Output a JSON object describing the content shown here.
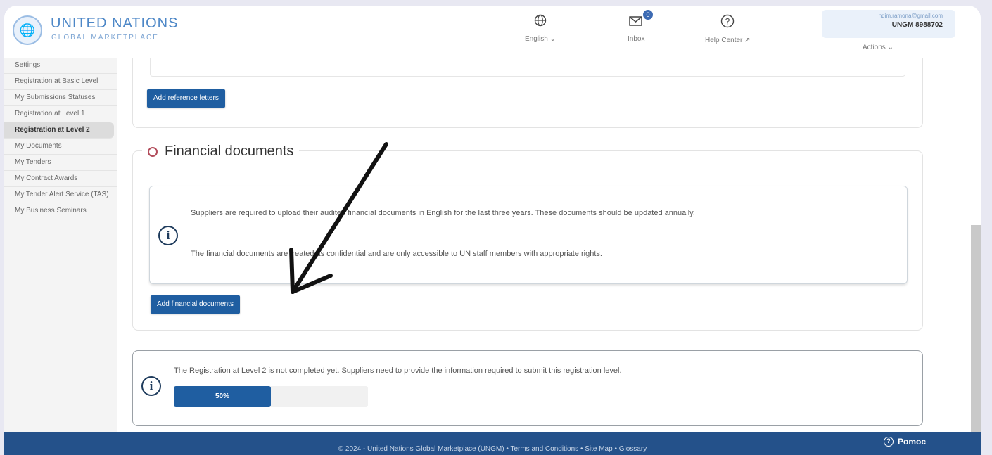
{
  "brand": {
    "title": "UNITED NATIONS",
    "subtitle": "GLOBAL MARKETPLACE"
  },
  "header": {
    "language_label": "English",
    "inbox_label": "Inbox",
    "inbox_count": "0",
    "help_label": "Help Center",
    "account_email": "ndim.ramona@gmail.com",
    "account_id": "UNGM 8988702",
    "actions_label": "Actions"
  },
  "sidebar": {
    "items": [
      {
        "label": "Settings"
      },
      {
        "label": "Registration at Basic Level"
      },
      {
        "label": "My Submissions Statuses"
      },
      {
        "label": "Registration at Level 1"
      },
      {
        "label": "Registration at Level 2"
      },
      {
        "label": "My Documents"
      },
      {
        "label": "My Tenders"
      },
      {
        "label": "My Contract Awards"
      },
      {
        "label": "My Tender Alert Service (TAS)"
      },
      {
        "label": "My Business Seminars"
      }
    ],
    "active_index": 4
  },
  "references": {
    "add_button": "Add reference letters"
  },
  "financial": {
    "title": "Financial documents",
    "info_line1": "Suppliers are required to upload their audited financial documents in English for the last three years. These documents should be updated annually.",
    "info_line2": "The financial documents are treated as confidential and are only accessible to UN staff members with appropriate rights.",
    "add_button": "Add financial documents"
  },
  "status": {
    "message": "The Registration at Level 2 is not completed yet. Suppliers need to provide the information required to submit this registration level.",
    "progress_label": "50%",
    "progress_fraction": 0.5
  },
  "footer": {
    "text": "© 2024 - United Nations Global Marketplace (UNGM) • Terms and Conditions • Site Map • Glossary",
    "help_button": "Pomoc"
  },
  "colors": {
    "primary": "#1f5ea1",
    "footer": "#24518a",
    "status_circle": "#b24b5a"
  }
}
